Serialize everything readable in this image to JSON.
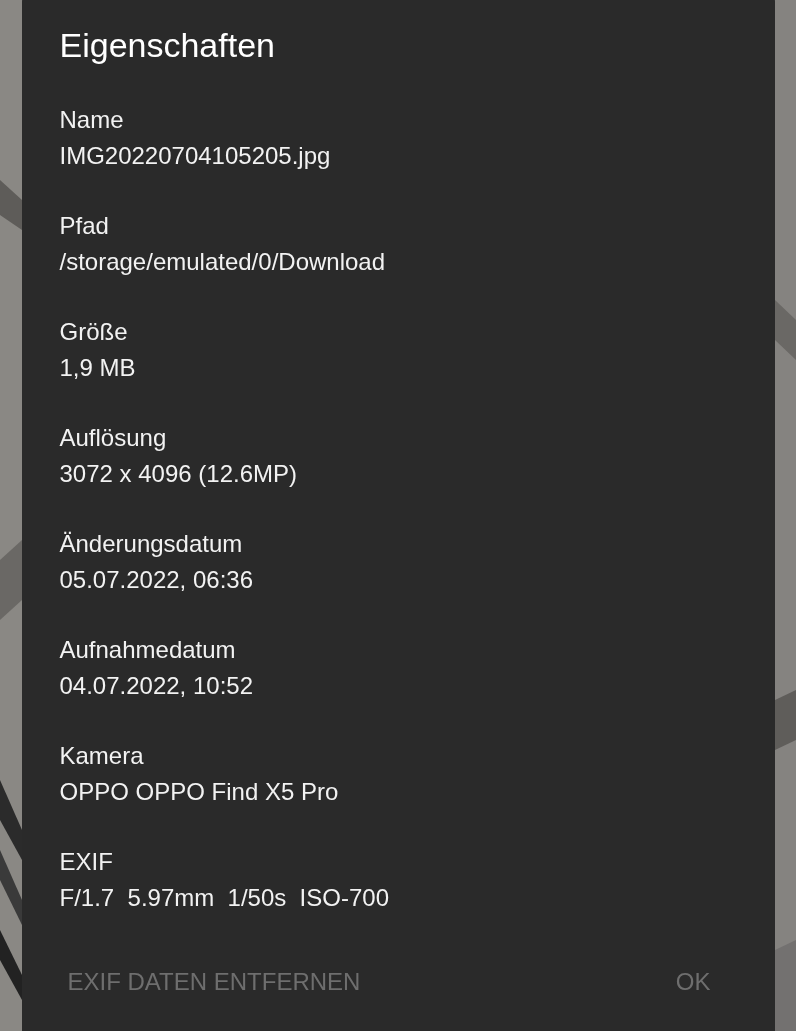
{
  "dialog": {
    "title": "Eigenschaften",
    "properties": [
      {
        "label": "Name",
        "value": "IMG20220704105205.jpg"
      },
      {
        "label": "Pfad",
        "value": "/storage/emulated/0/Download"
      },
      {
        "label": "Größe",
        "value": "1,9 MB"
      },
      {
        "label": "Auflösung",
        "value": "3072 x 4096 (12.6MP)"
      },
      {
        "label": "Änderungsdatum",
        "value": "05.07.2022, 06:36"
      },
      {
        "label": "Aufnahmedatum",
        "value": "04.07.2022, 10:52"
      },
      {
        "label": "Kamera",
        "value": "OPPO OPPO Find X5 Pro"
      },
      {
        "label": "EXIF",
        "value": "F/1.7  5.97mm  1/50s  ISO-700"
      }
    ],
    "buttons": [
      {
        "label": "EXIF DATEN ENTFERNEN"
      },
      {
        "label": "OK"
      }
    ]
  }
}
